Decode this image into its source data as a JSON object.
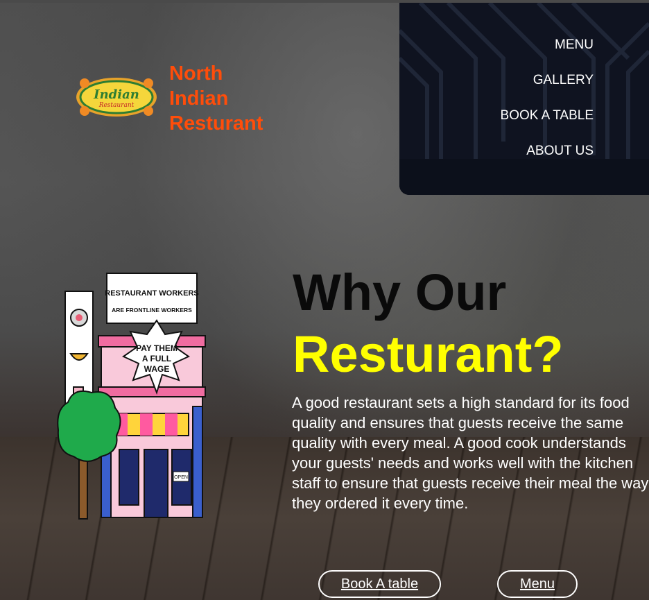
{
  "brand": {
    "line1": "North",
    "line2": "Indian",
    "line3": "Resturant",
    "logo_text1": "Indian",
    "logo_text2": "Restaurant",
    "color": "#ff4d0a"
  },
  "nav": {
    "items": [
      {
        "label": "MENU"
      },
      {
        "label": "GALLERY"
      },
      {
        "label": "BOOK A TABLE"
      },
      {
        "label": "ABOUT US"
      }
    ]
  },
  "hero": {
    "heading_line1": "Why Our",
    "heading_line2": "Resturant?",
    "heading_line2_color": "#ffff00",
    "description": "A good restaurant sets a high standard for its food quality and ensures that guests receive the same quality with every meal. A good cook understands your guests' needs and works well with the kitchen staff to ensure that guests receive their meal the way they ordered it every time."
  },
  "illustration": {
    "sign_line1": "RESTAURANT WORKERS",
    "sign_line2": "ARE FRONTLINE WORKERS",
    "badge_line1": "PAY THEM",
    "badge_line2": "A FULL",
    "badge_line3": "WAGE",
    "door_sign": "OPEN"
  },
  "buttons": {
    "book": "Book A table",
    "menu": "Menu"
  }
}
